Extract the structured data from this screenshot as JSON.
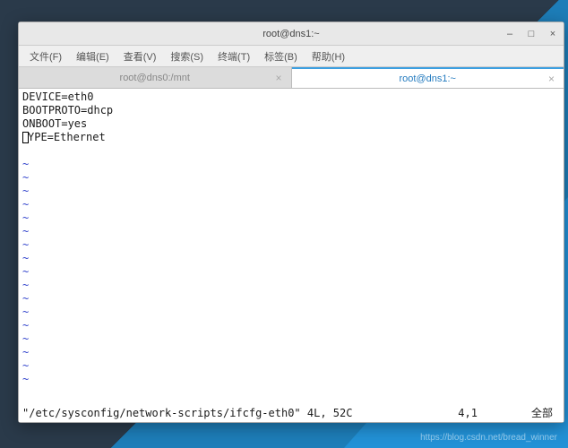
{
  "window": {
    "title": "root@dns1:~",
    "controls": {
      "min": "–",
      "max": "□",
      "close": "×"
    }
  },
  "menu": {
    "file": "文件(F)",
    "edit": "编辑(E)",
    "view": "查看(V)",
    "search": "搜索(S)",
    "terminal": "终端(T)",
    "tabs": "标签(B)",
    "help": "帮助(H)"
  },
  "tabs": [
    {
      "label": "root@dns0:/mnt",
      "active": false
    },
    {
      "label": "root@dns1:~",
      "active": true
    }
  ],
  "editor": {
    "lines": [
      "DEVICE=eth0",
      "BOOTPROTO=dhcp",
      "ONBOOT=yes",
      "TYPE=Ethernet"
    ],
    "cursor_line_index": 3,
    "tilde": "~",
    "status": {
      "file": "\"/etc/sysconfig/network-scripts/ifcfg-eth0\" 4L, 52C",
      "pos": "4,1",
      "all": "全部"
    }
  },
  "watermark": "https://blog.csdn.net/bread_winner"
}
